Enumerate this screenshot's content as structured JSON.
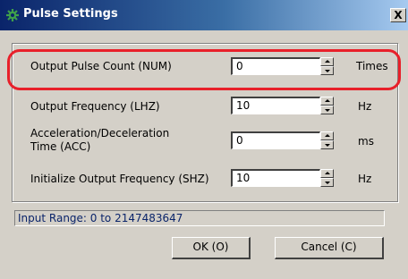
{
  "window": {
    "title": "Pulse Settings",
    "title_icon": "gear-icon",
    "close_label": "X"
  },
  "rows": [
    {
      "label": "Output Pulse Count (NUM)",
      "value": "0",
      "unit": "Times"
    },
    {
      "label": "Output Frequency (LHZ)",
      "value": "10",
      "unit": "Hz"
    },
    {
      "label_line1": "Acceleration/Deceleration",
      "label_line2": "Time (ACC)",
      "value": "0",
      "unit": "ms"
    },
    {
      "label": "Initialize Output Frequency (SHZ)",
      "value": "10",
      "unit": "Hz"
    }
  ],
  "status": {
    "text": "Input Range: 0 to 2147483647"
  },
  "buttons": {
    "ok": "OK (O)",
    "cancel": "Cancel (C)"
  },
  "colors": {
    "titlebar_start": "#0a246a",
    "titlebar_end": "#a6caf0",
    "highlight": "#e8202a",
    "dialog_bg": "#d4d0c8"
  }
}
